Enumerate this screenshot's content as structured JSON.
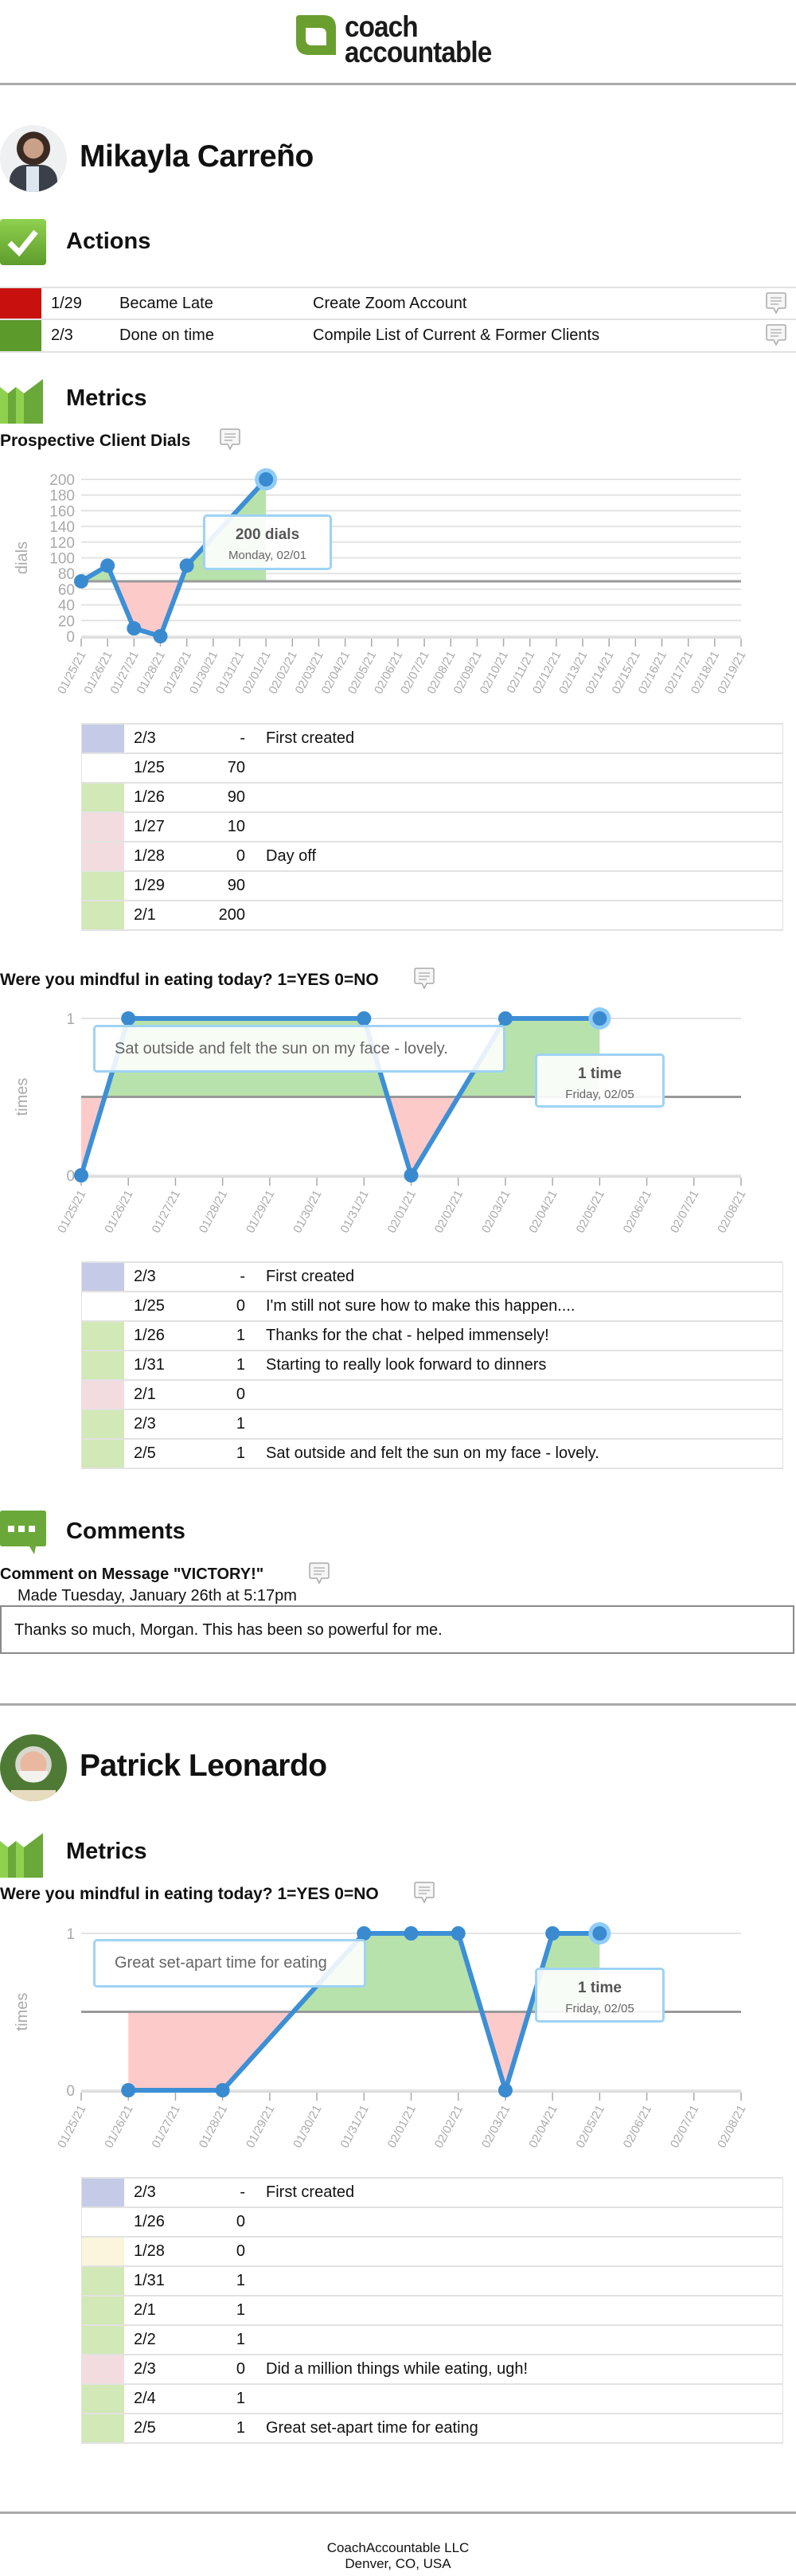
{
  "header": {
    "logo_line1": "coach",
    "logo_line2": "accountable"
  },
  "colors": {
    "brand_green": "#6a9f2f",
    "late_red": "#c8110e",
    "ontime_green": "#5c9a2c",
    "line_blue": "#3d8fd6",
    "fill_above": "#b8e2ac",
    "fill_below": "#fdcaca",
    "row_created": "#c5cbe6",
    "row_good": "#d2e8b6",
    "row_bad": "#f3dcdf",
    "row_neutral": "#faf5dc"
  },
  "clients": [
    {
      "name": "Mikayla Carreño",
      "actions_title": "Actions",
      "actions": [
        {
          "status_color": "late_red",
          "date": "1/29",
          "status": "Became Late",
          "title": "Create Zoom Account"
        },
        {
          "status_color": "ontime_green",
          "date": "2/3",
          "status": "Done on time",
          "title": "Compile List of Current & Former Clients"
        }
      ],
      "metrics_title": "Metrics",
      "comments_title": "Comments",
      "comment": {
        "heading": "Comment on Message \"VICTORY!\"",
        "made": "Made Tuesday, January 26th at 5:17pm",
        "text": "Thanks so much, Morgan. This has been so powerful for me."
      }
    },
    {
      "name": "Patrick Leonardo",
      "metrics_title": "Metrics"
    }
  ],
  "metrics": [
    {
      "title": "Prospective Client Dials",
      "tooltip": {
        "value": "200 dials",
        "date": "Monday, 02/01"
      },
      "rows": [
        {
          "color": "row_created",
          "date": "2/3",
          "value": "-",
          "note": "First created"
        },
        {
          "color": "",
          "date": "1/25",
          "value": "70",
          "note": ""
        },
        {
          "color": "row_good",
          "date": "1/26",
          "value": "90",
          "note": ""
        },
        {
          "color": "row_bad",
          "date": "1/27",
          "value": "10",
          "note": ""
        },
        {
          "color": "row_bad",
          "date": "1/28",
          "value": "0",
          "note": "Day off"
        },
        {
          "color": "row_good",
          "date": "1/29",
          "value": "90",
          "note": ""
        },
        {
          "color": "row_good",
          "date": "2/1",
          "value": "200",
          "note": ""
        }
      ]
    },
    {
      "title": "Were you mindful in eating today? 1=YES 0=NO",
      "note_tooltip": "Sat outside and felt the sun on my face - lovely.",
      "tooltip": {
        "value": "1 time",
        "date": "Friday, 02/05"
      },
      "rows": [
        {
          "color": "row_created",
          "date": "2/3",
          "value": "-",
          "note": "First created"
        },
        {
          "color": "",
          "date": "1/25",
          "value": "0",
          "note": "I'm still not sure how to make this happen...."
        },
        {
          "color": "row_good",
          "date": "1/26",
          "value": "1",
          "note": "Thanks for the chat - helped immensely!"
        },
        {
          "color": "row_good",
          "date": "1/31",
          "value": "1",
          "note": "Starting to really look forward to dinners"
        },
        {
          "color": "row_bad",
          "date": "2/1",
          "value": "0",
          "note": ""
        },
        {
          "color": "row_good",
          "date": "2/3",
          "value": "1",
          "note": ""
        },
        {
          "color": "row_good",
          "date": "2/5",
          "value": "1",
          "note": "Sat outside and felt the sun on my face - lovely."
        }
      ]
    },
    {
      "title": "Were you mindful in eating today? 1=YES 0=NO",
      "note_tooltip": "Great set-apart time for eating",
      "tooltip": {
        "value": "1 time",
        "date": "Friday, 02/05"
      },
      "rows": [
        {
          "color": "row_created",
          "date": "2/3",
          "value": "-",
          "note": "First created"
        },
        {
          "color": "",
          "date": "1/26",
          "value": "0",
          "note": ""
        },
        {
          "color": "row_neutral",
          "date": "1/28",
          "value": "0",
          "note": ""
        },
        {
          "color": "row_good",
          "date": "1/31",
          "value": "1",
          "note": ""
        },
        {
          "color": "row_good",
          "date": "2/1",
          "value": "1",
          "note": ""
        },
        {
          "color": "row_good",
          "date": "2/2",
          "value": "1",
          "note": ""
        },
        {
          "color": "row_bad",
          "date": "2/3",
          "value": "0",
          "note": "Did a million things while eating, ugh!"
        },
        {
          "color": "row_good",
          "date": "2/4",
          "value": "1",
          "note": ""
        },
        {
          "color": "row_good",
          "date": "2/5",
          "value": "1",
          "note": "Great set-apart time for eating"
        }
      ]
    }
  ],
  "chart_data": [
    {
      "type": "line",
      "ylabel": "dials",
      "ylim": [
        0,
        200
      ],
      "yticks": [
        0,
        20,
        40,
        60,
        80,
        100,
        120,
        140,
        160,
        180,
        200
      ],
      "grid": true,
      "baseline": 70,
      "categories": [
        "01/25/21",
        "01/26/21",
        "01/27/21",
        "01/28/21",
        "01/29/21",
        "01/30/21",
        "01/31/21",
        "02/01/21",
        "02/02/21",
        "02/03/21",
        "02/04/21",
        "02/05/21",
        "02/06/21",
        "02/07/21",
        "02/08/21",
        "02/09/21",
        "02/10/21",
        "02/11/21",
        "02/12/21",
        "02/13/21",
        "02/14/21",
        "02/15/21",
        "02/16/21",
        "02/17/21",
        "02/18/21",
        "02/19/21"
      ],
      "points": [
        [
          "01/25/21",
          70
        ],
        [
          "01/26/21",
          90
        ],
        [
          "01/27/21",
          10
        ],
        [
          "01/28/21",
          0
        ],
        [
          "01/29/21",
          90
        ],
        [
          "02/01/21",
          200
        ]
      ],
      "highlight": "02/01/21"
    },
    {
      "type": "line",
      "ylabel": "times",
      "ylim": [
        0,
        1
      ],
      "yticks": [
        0,
        1
      ],
      "grid": true,
      "baseline": 0.5,
      "categories": [
        "01/25/21",
        "01/26/21",
        "01/27/21",
        "01/28/21",
        "01/29/21",
        "01/30/21",
        "01/31/21",
        "02/01/21",
        "02/02/21",
        "02/03/21",
        "02/04/21",
        "02/05/21",
        "02/06/21",
        "02/07/21",
        "02/08/21"
      ],
      "points": [
        [
          "01/25/21",
          0
        ],
        [
          "01/26/21",
          1
        ],
        [
          "01/31/21",
          1
        ],
        [
          "02/01/21",
          0
        ],
        [
          "02/03/21",
          1
        ],
        [
          "02/05/21",
          1
        ]
      ],
      "highlight": "02/05/21"
    },
    {
      "type": "line",
      "ylabel": "times",
      "ylim": [
        0,
        1
      ],
      "yticks": [
        0,
        1
      ],
      "grid": true,
      "baseline": 0.5,
      "categories": [
        "01/25/21",
        "01/26/21",
        "01/27/21",
        "01/28/21",
        "01/29/21",
        "01/30/21",
        "01/31/21",
        "02/01/21",
        "02/02/21",
        "02/03/21",
        "02/04/21",
        "02/05/21",
        "02/06/21",
        "02/07/21",
        "02/08/21"
      ],
      "points": [
        [
          "01/26/21",
          0
        ],
        [
          "01/28/21",
          0
        ],
        [
          "01/31/21",
          1
        ],
        [
          "02/01/21",
          1
        ],
        [
          "02/02/21",
          1
        ],
        [
          "02/03/21",
          0
        ],
        [
          "02/04/21",
          1
        ],
        [
          "02/05/21",
          1
        ]
      ],
      "highlight": "02/05/21"
    }
  ],
  "footer": {
    "line1": "CoachAccountable LLC",
    "line2": "Denver, CO, USA"
  }
}
